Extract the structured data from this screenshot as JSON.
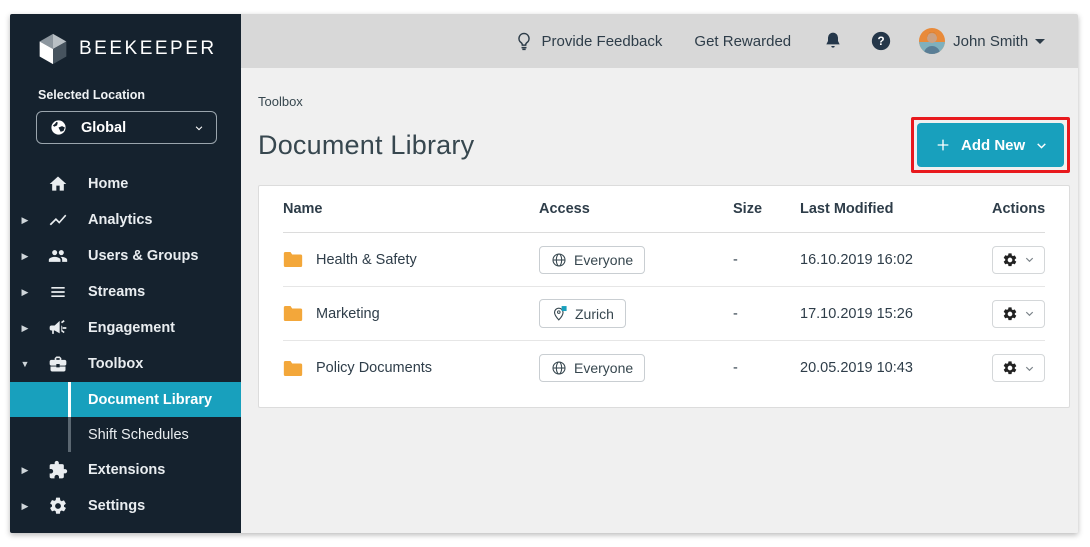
{
  "app": {
    "brand": "BEEKEEPER"
  },
  "topbar": {
    "feedback": "Provide Feedback",
    "rewarded": "Get Rewarded",
    "user_name": "John Smith"
  },
  "sidebar": {
    "location_label": "Selected Location",
    "location_value": "Global",
    "items": [
      {
        "label": "Home"
      },
      {
        "label": "Analytics"
      },
      {
        "label": "Users & Groups"
      },
      {
        "label": "Streams"
      },
      {
        "label": "Engagement"
      },
      {
        "label": "Toolbox"
      },
      {
        "label": "Extensions"
      },
      {
        "label": "Settings"
      }
    ],
    "submenu": [
      {
        "label": "Document Library"
      },
      {
        "label": "Shift Schedules"
      }
    ]
  },
  "page": {
    "breadcrumb": "Toolbox",
    "title": "Document Library",
    "add_new": "Add New"
  },
  "table": {
    "columns": [
      "Name",
      "Access",
      "Size",
      "Last Modified",
      "Actions"
    ],
    "rows": [
      {
        "name": "Health & Safety",
        "access": "Everyone",
        "access_icon": "globe-icon",
        "size": "-",
        "modified": "16.10.2019 16:02"
      },
      {
        "name": "Marketing",
        "access": "Zurich",
        "access_icon": "location-pin-icon",
        "size": "-",
        "modified": "17.10.2019 15:26"
      },
      {
        "name": "Policy Documents",
        "access": "Everyone",
        "access_icon": "globe-icon",
        "size": "-",
        "modified": "20.05.2019 10:43"
      }
    ]
  },
  "colors": {
    "accent_teal": "#18a0bd",
    "sidebar_bg": "#15222e",
    "topbar_bg": "#d8d8d8",
    "content_bg": "#f0f0f0",
    "folder_orange": "#f3a73a",
    "annotation_red": "#e8191d",
    "text_dark": "#2e3d49"
  }
}
